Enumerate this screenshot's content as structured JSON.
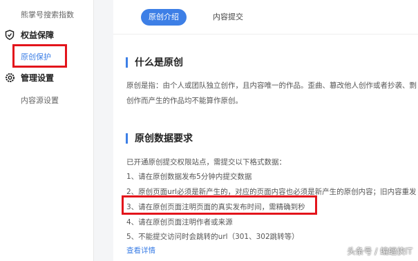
{
  "sidebar": {
    "top_item": "熊掌号搜索指数",
    "group_rights": {
      "label": "权益保障",
      "icon": "shield-icon"
    },
    "original_protect": "原创保护",
    "group_manage": {
      "label": "管理设置",
      "icon": "gear-icon"
    },
    "content_source": "内容源设置"
  },
  "tabs": {
    "intro": "原创介绍",
    "submit": "内容提交"
  },
  "sections": {
    "what_is": {
      "title": "什么是原创",
      "line1": "原创是指：由个人或团队独立创作，且内容唯一的作品。歪曲、篡改他人创作或者抄袭、剽",
      "line2": "创作而产生的作品均不能算作原创。"
    },
    "requirements": {
      "title": "原创数据要求",
      "intro": "已开通原创提交权限站点，需提交以下格式数据：",
      "items": [
        "1、请在原创数据发布5分钟内提交数据",
        "2、原创页面url必须是新产生的，对应的页面内容也必须是新产生的原创内容；旧内容重发",
        "3、请在原创页面注明页面的真实发布时间，需精确到秒",
        "4、请在原创页面注明作者或来源",
        "5、不能提交访问时会跳转的url（301、302跳转等）"
      ],
      "more_link": "查看详情"
    }
  },
  "watermark": "头条号 / 蝙蝠侠IT",
  "colors": {
    "accent": "#3d7fe6",
    "highlight_box": "#e3141b"
  }
}
